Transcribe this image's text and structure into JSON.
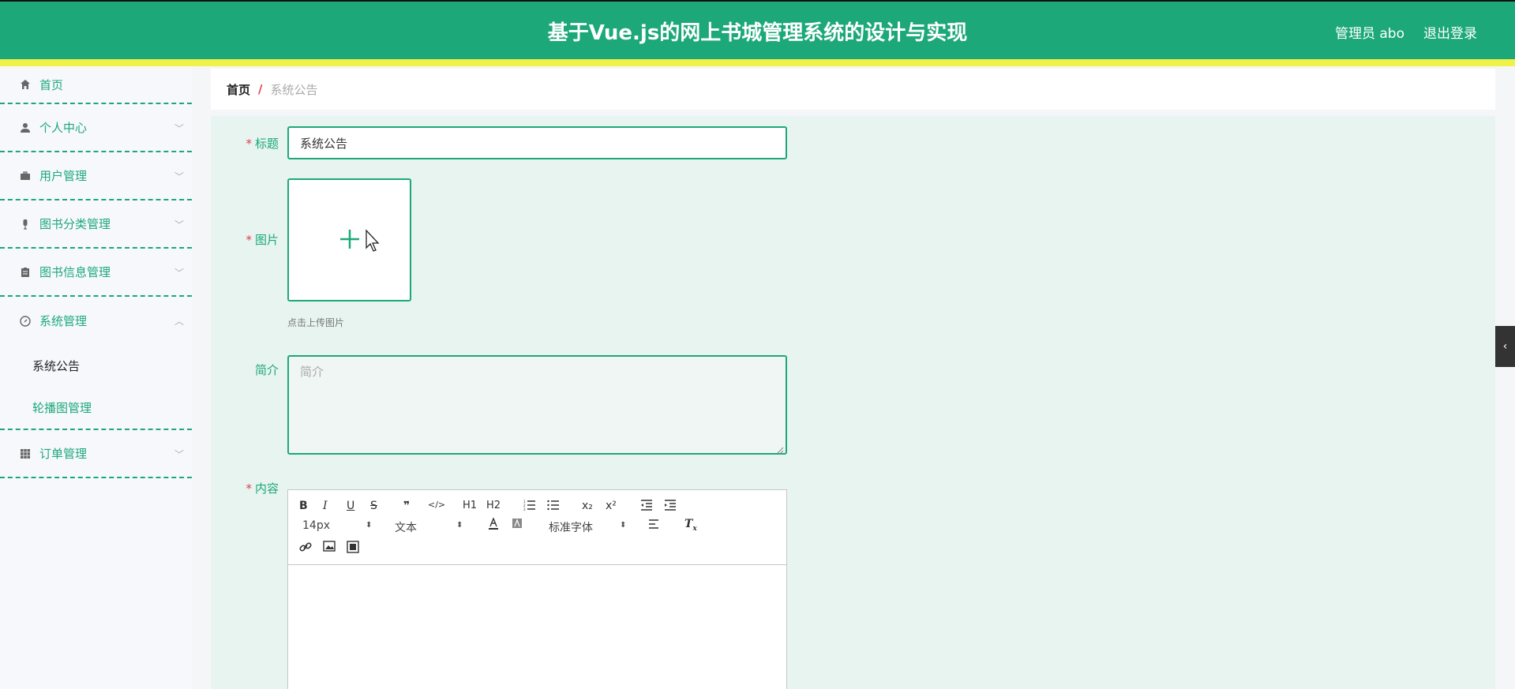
{
  "header": {
    "title": "基于Vue.js的网上书城管理系统的设计与实现",
    "user": "管理员 abo",
    "logout": "退出登录"
  },
  "sidebar": {
    "items": [
      {
        "label": "首页",
        "icon": "home-icon"
      },
      {
        "label": "个人中心",
        "icon": "user-icon"
      },
      {
        "label": "用户管理",
        "icon": "briefcase-icon"
      },
      {
        "label": "图书分类管理",
        "icon": "microphone-icon"
      },
      {
        "label": "图书信息管理",
        "icon": "clipboard-icon"
      },
      {
        "label": "系统管理",
        "icon": "compass-icon"
      },
      {
        "label": "订单管理",
        "icon": "grid-icon"
      }
    ],
    "sub_items": [
      {
        "label": "系统公告",
        "active": true
      },
      {
        "label": "轮播图管理",
        "active": false
      }
    ]
  },
  "breadcrumb": {
    "home": "首页",
    "separator": "/",
    "current": "系统公告"
  },
  "form": {
    "title_label": "标题",
    "title_value": "系统公告",
    "image_label": "图片",
    "upload_hint": "点击上传图片",
    "intro_label": "简介",
    "intro_placeholder": "简介",
    "content_label": "内容",
    "required_mark": "*"
  },
  "editor": {
    "font_size": "14px",
    "header_select": "文本",
    "font_select": "标准字体",
    "buttons": [
      "B",
      "I",
      "U",
      "S",
      "❞",
      "</>",
      "H1",
      "H2",
      "ordered-list",
      "bullet-list",
      "x₂",
      "x²",
      "outdent",
      "indent"
    ]
  },
  "colors": {
    "primary": "#1da87a",
    "accent_yellow": "#f0f24a",
    "required": "#e0424c",
    "form_bg": "#e7f4f0"
  }
}
